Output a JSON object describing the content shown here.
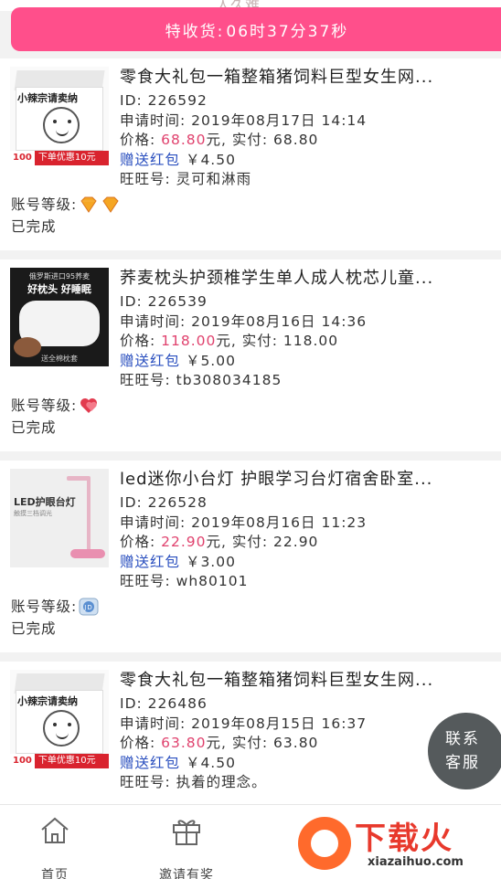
{
  "top": {
    "ghost_text": "人久难"
  },
  "banner": {
    "label": "特收货:",
    "countdown": "06时37分37秒"
  },
  "labels": {
    "id": "ID: ",
    "apply_time": "申请时间: ",
    "price": "价格: ",
    "yuan_paid": "元, 实付: ",
    "red_envelope": "赠送红包",
    "wangwang": "旺旺号: ",
    "account_level": "账号等级: "
  },
  "orders": [
    {
      "title": "零食大礼包一箱整箱猪饲料巨型女生网...",
      "id": "226592",
      "apply_time": "2019年08月17日 14:14",
      "price": "68.80",
      "paid": "68.80",
      "red_envelope_amount": " ￥4.50",
      "wangwang": "灵可和淋雨",
      "level_badges": [
        "diamond-icon",
        "diamond-icon"
      ],
      "status": "已完成",
      "thumb": {
        "brand": "小辣宗请卖纳",
        "bar_a": "100",
        "bar_b": "下单优惠10元"
      }
    },
    {
      "title": "荞麦枕头护颈椎学生单人成人枕芯儿童...",
      "id": "226539",
      "apply_time": "2019年08月16日 14:36",
      "price": "118.00",
      "paid": "118.00",
      "red_envelope_amount": " ￥5.00",
      "wangwang": "tb308034185",
      "level_badges": [
        "heart-icon"
      ],
      "status": "已完成",
      "thumb": {
        "line1": "俄罗斯进口95荞麦",
        "line2": "好枕头 好睡眠",
        "line3": "送全棉枕套"
      }
    },
    {
      "title": "led迷你小台灯 护眼学习台灯宿舍卧室...",
      "id": "226528",
      "apply_time": "2019年08月16日 11:23",
      "price": "22.90",
      "paid": "22.90",
      "red_envelope_amount": " ￥3.00",
      "wangwang": "wh80101",
      "level_badges": [
        "jd-icon"
      ],
      "status": "已完成",
      "thumb": {
        "line1": "LED护眼台灯",
        "line2": "触摸三档调光"
      }
    },
    {
      "title": "零食大礼包一箱整箱猪饲料巨型女生网...",
      "id": "226486",
      "apply_time": "2019年08月15日 16:37",
      "price": "63.80",
      "paid": "63.80",
      "red_envelope_amount": " ￥4.50",
      "wangwang": "执着的理念。",
      "level_badges": [
        "heart-icon",
        "heart-icon"
      ],
      "status": "",
      "thumb": {
        "brand": "小辣宗请卖纳",
        "bar_a": "100",
        "bar_b": "下单优惠10元"
      }
    }
  ],
  "float_service": {
    "line1": "联系",
    "line2": "客服"
  },
  "nav": [
    {
      "label": "首页",
      "icon": "home-icon"
    },
    {
      "label": "邀请有奖",
      "icon": "gift-icon"
    }
  ],
  "watermark": {
    "big": "下载火",
    "small": "xiazaihuo.com"
  },
  "colors": {
    "accent": "#ff4f8b",
    "price": "#e0426e",
    "link": "#2a4fbf"
  }
}
